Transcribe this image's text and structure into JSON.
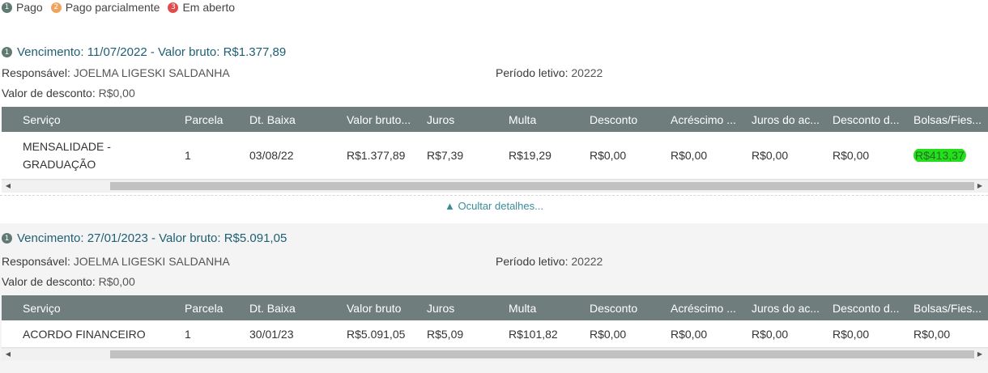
{
  "legend": [
    {
      "num": "1",
      "label": "Pago",
      "color": "#5f7a72"
    },
    {
      "num": "2",
      "label": "Pago parcialmente",
      "color": "#f0a35c"
    },
    {
      "num": "3",
      "label": "Em aberto",
      "color": "#e24b4b"
    }
  ],
  "columns": [
    "Serviço",
    "Parcela",
    "Dt. Baixa",
    "Valor bruto...",
    "Juros",
    "Multa",
    "Desconto",
    "Acréscimo ...",
    "Juros do ac...",
    "Desconto d...",
    "Bolsas/Fies..."
  ],
  "columns2": [
    "Serviço",
    "Parcela",
    "Dt. Baixa",
    "Valor bruto",
    "Juros",
    "Multa",
    "Desconto",
    "Acréscimo ...",
    "Juros do ac...",
    "Desconto d...",
    "Bolsas/Fies..."
  ],
  "section1": {
    "badge": "1",
    "due": "Vencimento: 11/07/2022 - Valor bruto: R$1.377,89",
    "responsavel_label": "Responsável:",
    "responsavel": "JOELMA LIGESKI SALDANHA",
    "periodo_label": "Período letivo:",
    "periodo": "20222",
    "desconto_label": "Valor de desconto:",
    "desconto": "R$0,00",
    "row": [
      "MENSALIDADE - GRADUAÇÃO",
      "1",
      "03/08/22",
      "R$1.377,89",
      "R$7,39",
      "R$19,29",
      "R$0,00",
      "R$0,00",
      "R$0,00",
      "R$0,00",
      "R$413,37"
    ],
    "toggle": "▲ Ocultar detalhes..."
  },
  "section2": {
    "badge": "1",
    "due": "Vencimento: 27/01/2023 - Valor bruto: R$5.091,05",
    "responsavel_label": "Responsável:",
    "responsavel": "JOELMA LIGESKI SALDANHA",
    "periodo_label": "Período letivo:",
    "periodo": "20222",
    "desconto_label": "Valor de desconto:",
    "desconto": "R$0,00",
    "row": [
      "ACORDO FINANCEIRO",
      "1",
      "30/01/23",
      "R$5.091,05",
      "R$5,09",
      "R$101,82",
      "R$0,00",
      "R$0,00",
      "R$0,00",
      "R$0,00",
      "R$0,00"
    ]
  }
}
